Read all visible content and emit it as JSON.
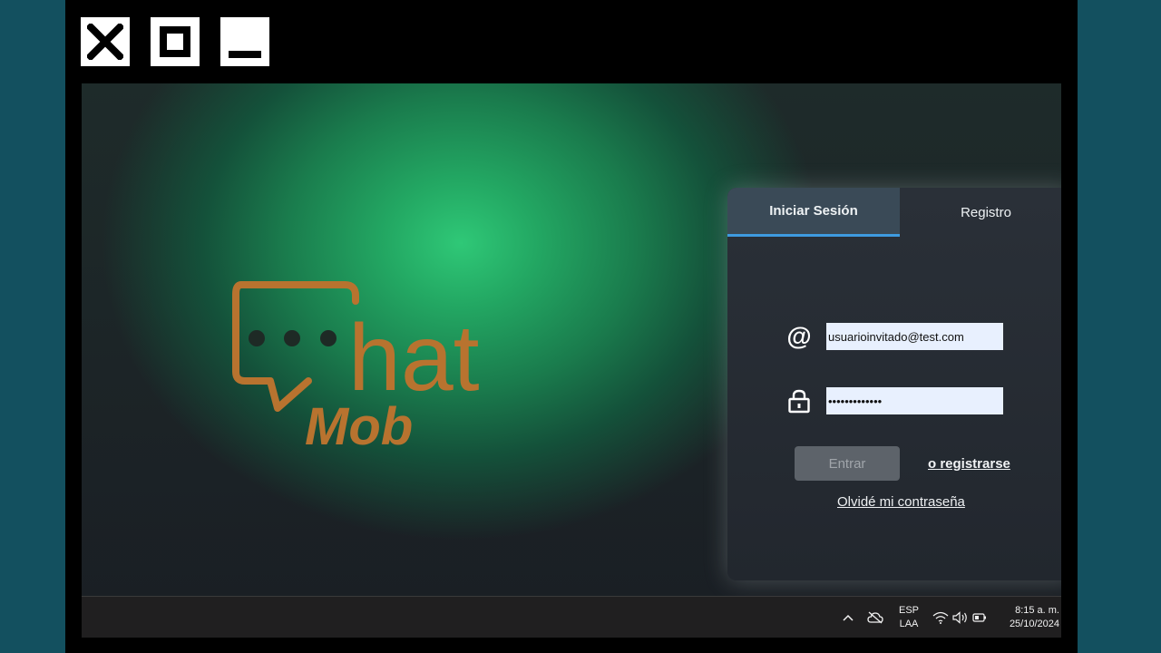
{
  "window_controls": {
    "close_icon": "close-icon",
    "maximize_icon": "maximize-icon",
    "minimize_icon": "minimize-icon"
  },
  "logo": {
    "word1": "hat",
    "word2": "Mob",
    "color": "#b8732f"
  },
  "login": {
    "tabs": [
      {
        "label": "Iniciar Sesión",
        "active": true
      },
      {
        "label": "Registro",
        "active": false
      }
    ],
    "email": {
      "icon": "at-icon",
      "value": "usuarioinvitado@test.com"
    },
    "password": {
      "icon": "lock-icon",
      "value": "•••••••••••••"
    },
    "submit_label": "Entrar",
    "register_link": "o registrarse",
    "forgot_link": "Olvidé mi contraseña",
    "accent": "#3e9be0"
  },
  "taskbar": {
    "language": {
      "line1": "ESP",
      "line2": "LAA"
    },
    "time": "8:15 a. m.",
    "date": "25/10/2024"
  }
}
